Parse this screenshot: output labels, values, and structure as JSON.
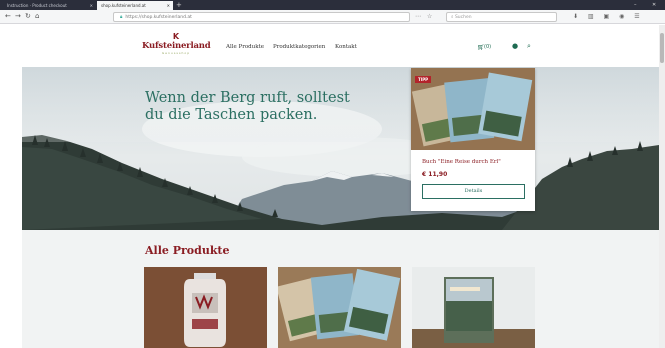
{
  "browser": {
    "tabs": [
      {
        "label": "Instruction · Product checkout",
        "active": false
      },
      {
        "label": "shop.kufsteinerland.at",
        "active": true
      }
    ],
    "url": "https://shop.kufsteinerland.at",
    "search_placeholder": "Suchen"
  },
  "site": {
    "logo": {
      "mark": "K",
      "name": "Kufsteinerland",
      "sub": "Genussshop"
    },
    "menu": [
      "Alle Produkte",
      "Produktkategorien",
      "Kontakt"
    ],
    "cart_label": "(0)",
    "hero": {
      "headline_line1": "Wenn der Berg ruft, solltest",
      "headline_line2": "du die Taschen packen."
    },
    "featured": {
      "badge": "TIPP",
      "title": "Buch \"Eine Reise durch Erl\"",
      "price": "€ 11,90",
      "button": "Details"
    },
    "section_title": "Alle Produkte"
  },
  "colors": {
    "brand_red": "#8a1c22",
    "brand_green": "#2b6f62",
    "section_bg": "#f1f3f3"
  }
}
